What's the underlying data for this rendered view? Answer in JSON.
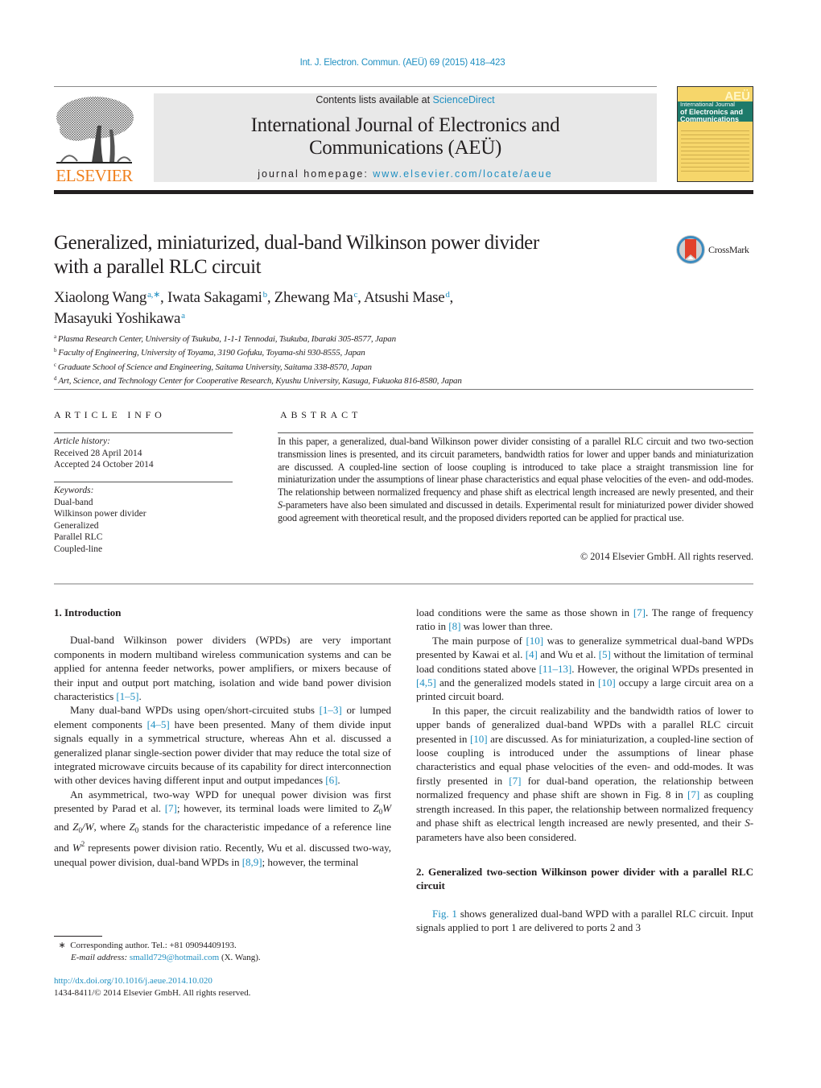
{
  "header": {
    "citation": "Int. J. Electron. Commun. (AEÜ) 69 (2015) 418–423",
    "contents_prefix": "Contents lists available at ",
    "contents_link": "ScienceDirect",
    "journal_title_line1": "International Journal of Electronics and",
    "journal_title_line2": "Communications (AEÜ)",
    "homepage_prefix": "journal homepage: ",
    "homepage_link": "www.elsevier.com/locate/aeue",
    "publisher_logo": "ELSEVIER",
    "cover": {
      "badge": "AEÜ",
      "line1": "International Journal",
      "line2": "of Electronics and",
      "line3": "Communications"
    },
    "colors": {
      "link": "#1f8fc1",
      "elsevier_orange": "#f07f1b",
      "cover_band": "#1d7a6a"
    }
  },
  "article": {
    "title_line1": "Generalized, miniaturized, dual-band Wilkinson power divider",
    "title_line2": "with a parallel RLC circuit",
    "crossmark_label": "CrossMark",
    "authors": [
      {
        "name": "Xiaolong Wang",
        "aff": "a,∗",
        "sep": ", "
      },
      {
        "name": "Iwata Sakagami",
        "aff": "b",
        "sep": ", "
      },
      {
        "name": "Zhewang Ma",
        "aff": "c",
        "sep": ", "
      },
      {
        "name": "Atsushi Mase",
        "aff": "d",
        "sep": ","
      },
      {
        "name": "Masayuki Yoshikawa",
        "aff": "a",
        "sep": ""
      }
    ],
    "affiliations": [
      {
        "key": "a",
        "text": "Plasma Research Center, University of Tsukuba, 1-1-1 Tennodai, Tsukuba, Ibaraki 305-8577, Japan"
      },
      {
        "key": "b",
        "text": "Faculty of Engineering, University of Toyama, 3190 Gofuku, Toyama-shi 930-8555, Japan"
      },
      {
        "key": "c",
        "text": "Graduate School of Science and Engineering, Saitama University, Saitama 338-8570, Japan"
      },
      {
        "key": "d",
        "text": "Art, Science, and Technology Center for Cooperative Research, Kyushu University, Kasuga, Fukuoka 816-8580, Japan"
      }
    ]
  },
  "article_info": {
    "heading": "ARTICLE INFO",
    "history_label": "Article history:",
    "received": "Received 28 April 2014",
    "accepted": "Accepted 24 October 2014",
    "keywords_label": "Keywords:",
    "keywords": [
      "Dual-band",
      "Wilkinson power divider",
      "Generalized",
      "Parallel RLC",
      "Coupled-line"
    ]
  },
  "abstract": {
    "heading": "ABSTRACT",
    "text_part1": "In this paper, a generalized, dual-band Wilkinson power divider consisting of a parallel RLC circuit and two two-section transmission lines is presented, and its circuit parameters, bandwidth ratios for lower and upper bands and miniaturization are discussed. A coupled-line section of loose coupling is introduced to take place a straight transmission line for miniaturization under the assumptions of linear phase characteristics and equal phase velocities of the even- and odd-modes. The relationship between normalized frequency and phase shift as electrical length increased are newly presented, and their ",
    "text_italic": "S",
    "text_part2": "-parameters have also been simulated and discussed in details. Experimental result for miniaturized power divider showed good agreement with theoretical result, and the proposed dividers reported can be applied for practical use.",
    "copyright": "© 2014 Elsevier GmbH. All rights reserved."
  },
  "body": {
    "section1_heading": "1.  Introduction",
    "p1": {
      "t1": "Dual-band Wilkinson power dividers (WPDs) are very important components in modern multiband wireless communication systems and can be applied for antenna feeder networks, power amplifiers, or mixers because of their input and output port matching, isolation and wide band power division characteristics ",
      "r1": "[1–5]",
      "t2": "."
    },
    "p2": {
      "t1": "Many dual-band WPDs using open/short-circuited stubs ",
      "r1": "[1–3]",
      "t2": " or lumped element components ",
      "r2": "[4–5]",
      "t3": " have been presented. Many of them divide input signals equally in a symmetrical structure, whereas Ahn et al. discussed a generalized planar single-section power divider that may reduce the total size of integrated microwave circuits because of its capability for direct interconnection with other devices having different input and output impedances ",
      "r3": "[6]",
      "t4": "."
    },
    "p3": {
      "t1": "An asymmetrical, two-way WPD for unequal power division was first presented by Parad et al. ",
      "r1": "[7]",
      "t2": "; however, its terminal loads were limited to ",
      "m1": "Z",
      "m1sub": "0",
      "m1b": "W",
      "t3": " and ",
      "m2": "Z",
      "m2sub": "0",
      "m2b": "/W",
      "t4": ", where ",
      "m3": "Z",
      "m3sub": "0",
      "t5": " stands for the characteristic impedance of a reference line and ",
      "m4": "W",
      "m4sup": "2",
      "t6": " represents power division ratio. Recently, Wu et al. discussed two-way, unequal power division, dual-band WPDs in ",
      "r2": "[8,9]",
      "t7": "; however, the terminal"
    },
    "p4": {
      "t1": "load conditions were the same as those shown in ",
      "r1": "[7]",
      "t2": ". The range of frequency ratio in ",
      "r2": "[8]",
      "t3": " was lower than three."
    },
    "p5": {
      "t1": "The main purpose of ",
      "r1": "[10]",
      "t2": " was to generalize symmetrical dual-band WPDs presented by Kawai et al. ",
      "r2": "[4]",
      "t3": " and Wu et al. ",
      "r3": "[5]",
      "t4": " without the limitation of terminal load conditions stated above ",
      "r4": "[11–13]",
      "t5": ". However, the original WPDs presented in ",
      "r5": "[4,5]",
      "t6": " and the generalized models stated in ",
      "r6": "[10]",
      "t7": " occupy a large circuit area on a printed circuit board."
    },
    "p6": {
      "t1": "In this paper, the circuit realizability and the bandwidth ratios of lower to upper bands of generalized dual-band WPDs with a parallel RLC circuit presented in ",
      "r1": "[10]",
      "t2": " are discussed. As for miniaturization, a coupled-line section of loose coupling is introduced under the assumptions of linear phase characteristics and equal phase velocities of the even- and odd-modes. It was firstly presented in ",
      "r2": "[7]",
      "t3": " for dual-band operation, the relationship between normalized frequency and phase shift are shown in Fig. 8 in ",
      "r3": "[7]",
      "t4": " as coupling strength increased. In this paper, the relationship between normalized frequency and phase shift as electrical length increased are newly presented, and their ",
      "i1": "S",
      "t5": "-parameters have also been considered."
    },
    "section2_heading": "2.  Generalized two-section Wilkinson power divider with a parallel RLC circuit",
    "p7": {
      "r1": "Fig. 1",
      "t1": " shows generalized dual-band WPD with a parallel RLC circuit. Input signals applied to port 1 are delivered to ports 2 and 3"
    }
  },
  "footnotes": {
    "star": "∗",
    "corresponding": "Corresponding author. Tel.: +81 09094409193.",
    "email_label": "E-mail address: ",
    "email": "smalld729@hotmail.com",
    "email_suffix": " (X. Wang).",
    "doi": "http://dx.doi.org/10.1016/j.aeue.2014.10.020",
    "issn_line": "1434-8411/© 2014 Elsevier GmbH. All rights reserved."
  }
}
